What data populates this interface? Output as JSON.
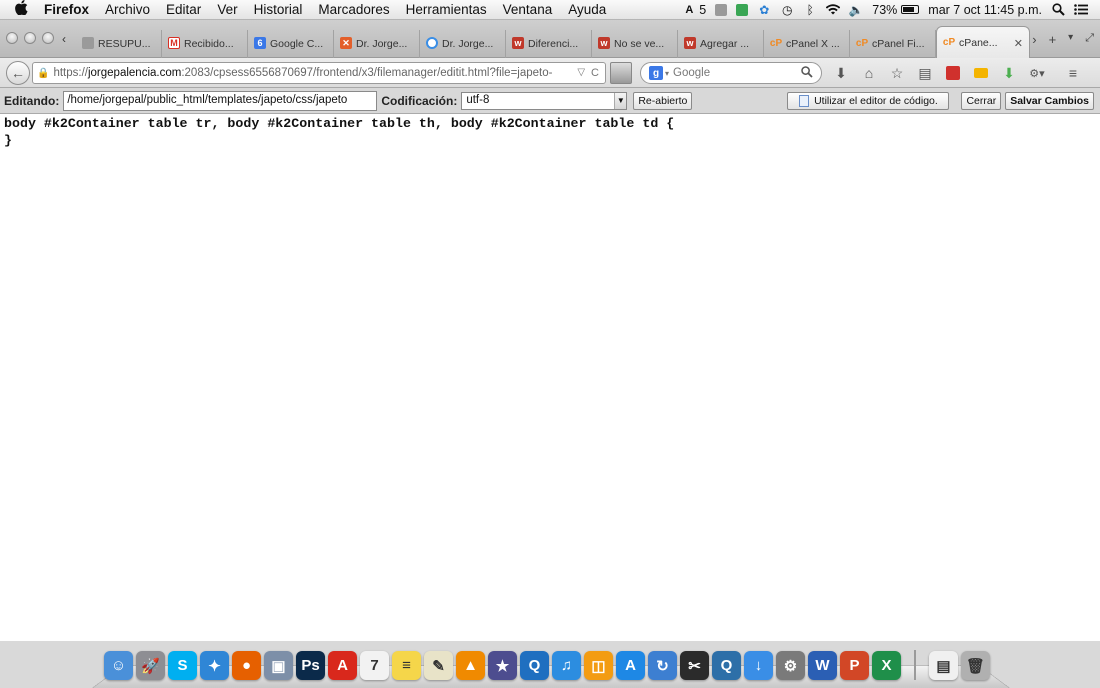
{
  "menubar": {
    "app_name": "Firefox",
    "items": [
      "Archivo",
      "Editar",
      "Ver",
      "Historial",
      "Marcadores",
      "Herramientas",
      "Ventana",
      "Ayuda"
    ],
    "status": {
      "adobe_count": "5",
      "battery": "73%",
      "datetime": "mar 7 oct  11:45 p.m."
    }
  },
  "tabs": [
    {
      "label": "RESUPU...",
      "favicon": "page-icon",
      "color": "#9a9a9a"
    },
    {
      "label": "Recibido...",
      "favicon": "gmail-icon",
      "color": "#d93025"
    },
    {
      "label": "Google C...",
      "favicon": "google-calendar-icon",
      "color": "#3b78e7"
    },
    {
      "label": "Dr. Jorge...",
      "favicon": "joomla-icon",
      "color": "#e35f2a"
    },
    {
      "label": "Dr. Jorge...",
      "favicon": "loading-icon",
      "color": "#3a8ee6"
    },
    {
      "label": "Diferenci...",
      "favicon": "w-icon",
      "color": "#c0392b"
    },
    {
      "label": "No se ve...",
      "favicon": "w-icon",
      "color": "#c0392b"
    },
    {
      "label": "Agregar ...",
      "favicon": "w-icon",
      "color": "#c0392b"
    },
    {
      "label": "cPanel X ...",
      "favicon": "cpanel-icon",
      "color": "#f08a24"
    },
    {
      "label": "cPanel Fi...",
      "favicon": "cpanel-icon",
      "color": "#f08a24"
    },
    {
      "label": "cPane...",
      "favicon": "cpanel-icon",
      "color": "#f08a24",
      "active": true
    }
  ],
  "navbar": {
    "url_prefix": "https://",
    "url_domain": "jorgepalencia.com",
    "url_rest": ":2083/cpsess6556870697/frontend/x3/filemanager/editit.html?file=japeto-",
    "search_placeholder": "Google"
  },
  "editor": {
    "editing_label": "Editando:",
    "path": "/home/jorgepal/public_html/templates/japeto/css/japeto",
    "encoding_label": "Codificación:",
    "encoding": "utf-8",
    "reopen_label": "Re-abierto",
    "code_editor_label": "Utilizar el editor de código.",
    "close_label": "Cerrar",
    "save_label": "Salvar Cambios",
    "code": "body #k2Container table tr, body #k2Container table th, body #k2Container table td {\n}"
  },
  "dock": [
    {
      "name": "finder-icon",
      "color": "#4a90d9",
      "glyph": "☺"
    },
    {
      "name": "launchpad-icon",
      "color": "#8e8e93",
      "glyph": "🚀"
    },
    {
      "name": "skype-icon",
      "color": "#00aff0",
      "glyph": "S"
    },
    {
      "name": "safari-icon",
      "color": "#2f86d6",
      "glyph": "✦"
    },
    {
      "name": "firefox-icon",
      "color": "#e66000",
      "glyph": "●"
    },
    {
      "name": "preview-icon",
      "color": "#7d8fa8",
      "glyph": "▣"
    },
    {
      "name": "photoshop-icon",
      "color": "#0b2a4a",
      "glyph": "Ps"
    },
    {
      "name": "acrobat-icon",
      "color": "#d9281c",
      "glyph": "A"
    },
    {
      "name": "calendar-icon",
      "color": "#f2f2f2",
      "glyph": "7"
    },
    {
      "name": "stickies-icon",
      "color": "#f5d64a",
      "glyph": "≡"
    },
    {
      "name": "notes-icon",
      "color": "#e8e3c8",
      "glyph": "✎"
    },
    {
      "name": "vlc-icon",
      "color": "#f08a00",
      "glyph": "▲"
    },
    {
      "name": "imovie-icon",
      "color": "#4d4d8f",
      "glyph": "★"
    },
    {
      "name": "quicktime-icon",
      "color": "#1f6fc0",
      "glyph": "Q"
    },
    {
      "name": "itunes-icon",
      "color": "#2c8de0",
      "glyph": "♫"
    },
    {
      "name": "ibooks-icon",
      "color": "#f39c12",
      "glyph": "◫"
    },
    {
      "name": "appstore-icon",
      "color": "#1e88e5",
      "glyph": "A"
    },
    {
      "name": "sync-icon",
      "color": "#3d7fd1",
      "glyph": "↻"
    },
    {
      "name": "finalcut-icon",
      "color": "#2b2b2b",
      "glyph": "✂"
    },
    {
      "name": "quicktime-player-icon",
      "color": "#2d6fa8",
      "glyph": "Q"
    },
    {
      "name": "download-icon",
      "color": "#3a8ee6",
      "glyph": "↓"
    },
    {
      "name": "system-prefs-icon",
      "color": "#7a7a7a",
      "glyph": "⚙"
    },
    {
      "name": "word-icon",
      "color": "#2b5fb4",
      "glyph": "W"
    },
    {
      "name": "powerpoint-icon",
      "color": "#d24726",
      "glyph": "P"
    },
    {
      "name": "excel-icon",
      "color": "#1f8f4a",
      "glyph": "X"
    }
  ],
  "dock_right": [
    {
      "name": "document-icon",
      "color": "#f0f0f0",
      "glyph": "▤"
    },
    {
      "name": "trash-icon",
      "color": "#b0b0b0",
      "glyph": "🗑"
    }
  ]
}
